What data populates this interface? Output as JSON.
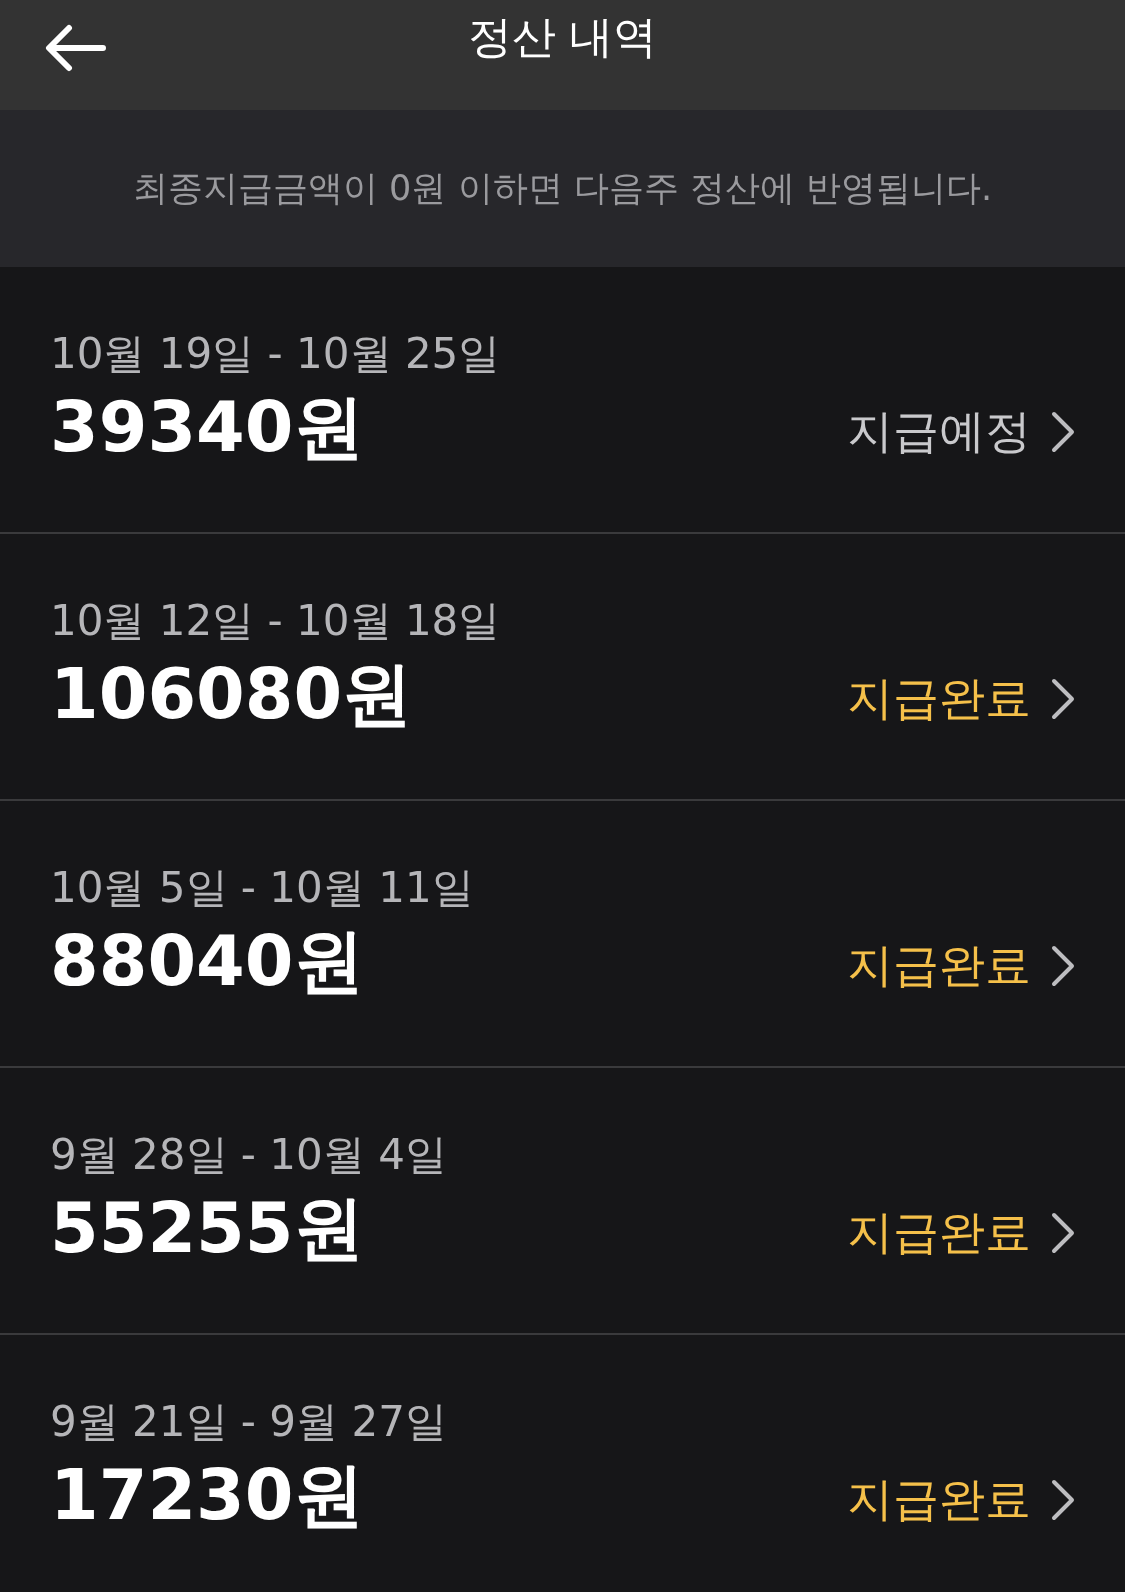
{
  "header": {
    "title": "정산 내역"
  },
  "notice": "최종지급금액이 0원 이하면 다음주 정산에 반영됩니다.",
  "settlements": [
    {
      "period": "10월 19일 - 10월 25일",
      "amount": "39340원",
      "status": {
        "text": "지급예정",
        "kind": "scheduled"
      }
    },
    {
      "period": "10월 12일 - 10월 18일",
      "amount": "106080원",
      "status": {
        "text": "지급완료",
        "kind": "completed"
      }
    },
    {
      "period": "10월 5일 - 10월 11일",
      "amount": "88040원",
      "status": {
        "text": "지급완료",
        "kind": "completed"
      }
    },
    {
      "period": "9월 28일 - 10월 4일",
      "amount": "55255원",
      "status": {
        "text": "지급완료",
        "kind": "completed"
      }
    },
    {
      "period": "9월 21일 - 9월 27일",
      "amount": "17230원",
      "status": {
        "text": "지급완료",
        "kind": "completed"
      }
    }
  ]
}
